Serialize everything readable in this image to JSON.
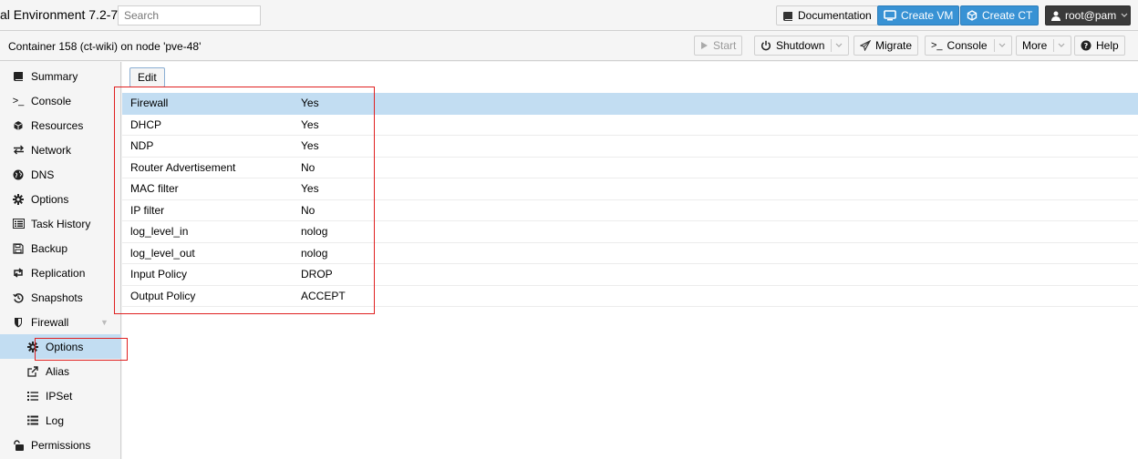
{
  "header": {
    "app_title": "al Environment 7.2-7",
    "search_placeholder": "Search",
    "documentation_label": "Documentation",
    "create_vm_label": "Create VM",
    "create_ct_label": "Create CT",
    "user_label": "root@pam"
  },
  "container": {
    "title": "Container 158 (ct-wiki) on node 'pve-48'",
    "start_label": "Start",
    "shutdown_label": "Shutdown",
    "migrate_label": "Migrate",
    "console_label": "Console",
    "more_label": "More",
    "help_label": "Help"
  },
  "sidebar": {
    "items": [
      {
        "label": "Summary",
        "icon": "book-icon"
      },
      {
        "label": "Console",
        "icon": "terminal-icon"
      },
      {
        "label": "Resources",
        "icon": "cube-icon"
      },
      {
        "label": "Network",
        "icon": "exchange-icon"
      },
      {
        "label": "DNS",
        "icon": "globe-icon"
      },
      {
        "label": "Options",
        "icon": "gear-icon"
      },
      {
        "label": "Task History",
        "icon": "list-alt-icon"
      },
      {
        "label": "Backup",
        "icon": "floppy-icon"
      },
      {
        "label": "Replication",
        "icon": "retweet-icon"
      },
      {
        "label": "Snapshots",
        "icon": "history-icon"
      },
      {
        "label": "Firewall",
        "icon": "shield-icon"
      },
      {
        "label": "Options",
        "icon": "gear-icon"
      },
      {
        "label": "Alias",
        "icon": "external-link-icon"
      },
      {
        "label": "IPSet",
        "icon": "list-ol-icon"
      },
      {
        "label": "Log",
        "icon": "list-icon"
      },
      {
        "label": "Permissions",
        "icon": "unlock-icon"
      }
    ]
  },
  "main": {
    "edit_label": "Edit",
    "rows": [
      {
        "key": "Firewall",
        "value": "Yes"
      },
      {
        "key": "DHCP",
        "value": "Yes"
      },
      {
        "key": "NDP",
        "value": "Yes"
      },
      {
        "key": "Router Advertisement",
        "value": "No"
      },
      {
        "key": "MAC filter",
        "value": "Yes"
      },
      {
        "key": "IP filter",
        "value": "No"
      },
      {
        "key": "log_level_in",
        "value": "nolog"
      },
      {
        "key": "log_level_out",
        "value": "nolog"
      },
      {
        "key": "Input Policy",
        "value": "DROP"
      },
      {
        "key": "Output Policy",
        "value": "ACCEPT"
      }
    ]
  },
  "colors": {
    "selection": "#c2ddf2",
    "accent_blue": "#3892d4",
    "annotation_red": "#e02020"
  }
}
